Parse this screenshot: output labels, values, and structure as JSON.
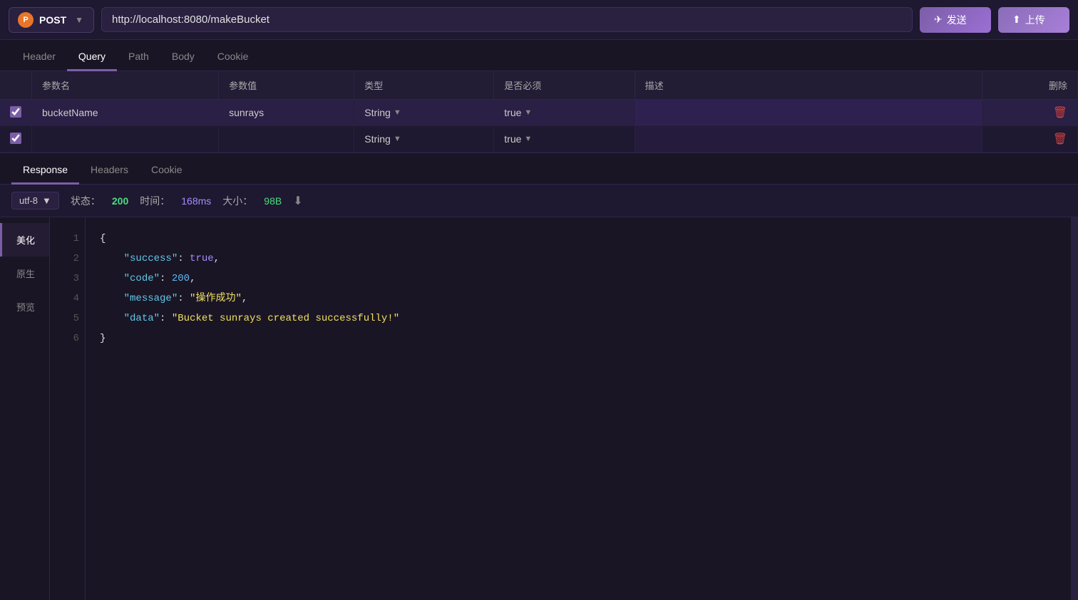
{
  "topbar": {
    "method": "POST",
    "method_icon": "P",
    "url": "http://localhost:8080/makeBucket",
    "send_label": "发送",
    "upload_label": "上传"
  },
  "request_tabs": [
    {
      "id": "header",
      "label": "Header",
      "active": false
    },
    {
      "id": "query",
      "label": "Query",
      "active": true
    },
    {
      "id": "path",
      "label": "Path",
      "active": false
    },
    {
      "id": "body",
      "label": "Body",
      "active": false
    },
    {
      "id": "cookie",
      "label": "Cookie",
      "active": false
    }
  ],
  "query_table": {
    "columns": [
      "参数名",
      "参数值",
      "类型",
      "是否必须",
      "描述",
      "删除"
    ],
    "rows": [
      {
        "checked": true,
        "param_name": "bucketName",
        "param_value": "sunrays",
        "type": "String",
        "required": "true",
        "description": "",
        "highlighted": true
      },
      {
        "checked": true,
        "param_name": "",
        "param_value": "",
        "type": "String",
        "required": "true",
        "description": "",
        "highlighted": false
      }
    ]
  },
  "response_tabs": [
    {
      "id": "response",
      "label": "Response",
      "active": true
    },
    {
      "id": "headers",
      "label": "Headers",
      "active": false
    },
    {
      "id": "cookie",
      "label": "Cookie",
      "active": false
    }
  ],
  "status_bar": {
    "encoding_label": "utf-8",
    "status_label": "状态：",
    "status_code": "200",
    "time_label": "时间：",
    "time_value": "168ms",
    "size_label": "大小：",
    "size_value": "98B"
  },
  "view_options": [
    {
      "id": "beautify",
      "label": "美化",
      "active": true
    },
    {
      "id": "raw",
      "label": "原生",
      "active": false
    },
    {
      "id": "preview",
      "label": "预览",
      "active": false
    }
  ],
  "code": {
    "lines": [
      "1",
      "2",
      "3",
      "4",
      "5",
      "6"
    ],
    "content": [
      {
        "line": 1,
        "text": "{"
      },
      {
        "line": 2,
        "key": "\"success\"",
        "colon": ": ",
        "value": "true",
        "comma": ","
      },
      {
        "line": 3,
        "key": "\"code\"",
        "colon": ": ",
        "value": "200",
        "comma": ","
      },
      {
        "line": 4,
        "key": "\"message\"",
        "colon": ": ",
        "value": "\"操作成功\"",
        "comma": ","
      },
      {
        "line": 5,
        "key": "\"data\"",
        "colon": ": ",
        "value": "\"Bucket sunrays created successfully!\"",
        "comma": ""
      },
      {
        "line": 6,
        "text": "}"
      }
    ]
  }
}
